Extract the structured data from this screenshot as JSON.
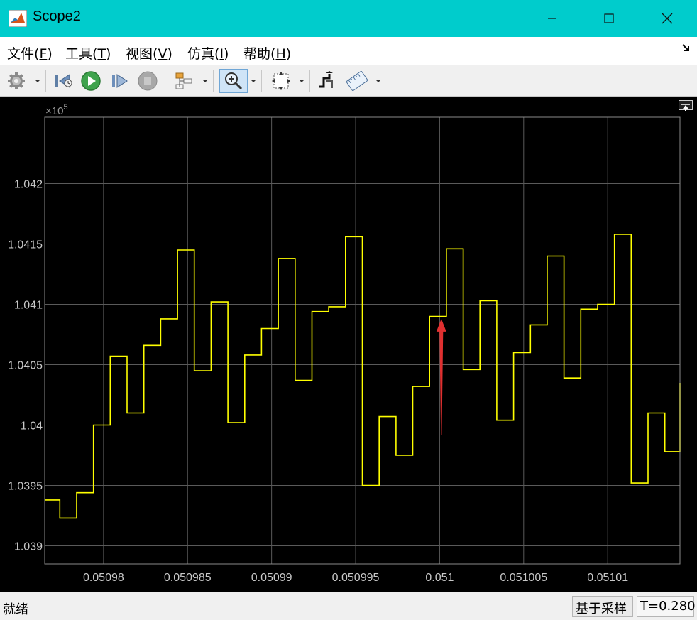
{
  "window": {
    "title": "Scope2"
  },
  "menu": {
    "items": [
      {
        "label": "文件",
        "accel": "F"
      },
      {
        "label": "工具",
        "accel": "T"
      },
      {
        "label": "视图",
        "accel": "V"
      },
      {
        "label": "仿真",
        "accel": "I"
      },
      {
        "label": "帮助",
        "accel": "H"
      }
    ]
  },
  "toolbar": {
    "icons": [
      "gear-icon",
      "step-back-icon",
      "run-icon",
      "step-forward-icon",
      "stop-icon",
      "signal-selector-icon",
      "zoom-in-icon",
      "fit-axes-icon",
      "triggers-icon",
      "cursor-measure-icon"
    ]
  },
  "colors": {
    "titlebar": "#00cccc",
    "plot_bg": "#000000",
    "trace": "#ffff00",
    "grid": "#5a5a5a",
    "arrow": "#e03030"
  },
  "chart_data": {
    "type": "line",
    "step": true,
    "exponent_label": "×10",
    "exponent_power": "5",
    "xlim": [
      0.0509765,
      0.0510143
    ],
    "ylim": [
      1.03885,
      1.04255
    ],
    "xticks": [
      0.05098,
      0.050985,
      0.05099,
      0.050995,
      0.051,
      0.051005,
      0.05101
    ],
    "xtick_labels": [
      "0.05098",
      "0.050985",
      "0.05099",
      "0.050995",
      "0.051",
      "0.051005",
      "0.05101"
    ],
    "yticks": [
      1.039,
      1.0395,
      1.04,
      1.0405,
      1.041,
      1.0415,
      1.042
    ],
    "ytick_labels": [
      "1.039",
      "1.0395",
      "1.04",
      "1.0405",
      "1.041",
      "1.0415",
      "1.042"
    ],
    "grid": true,
    "series": [
      {
        "x": [
          0.0509765,
          0.0509774,
          0.0509784,
          0.0509794,
          0.0509804,
          0.0509814,
          0.0509824,
          0.0509834,
          0.0509844,
          0.0509854,
          0.0509864,
          0.0509874,
          0.0509884,
          0.0509894,
          0.0509904,
          0.0509914,
          0.0509924,
          0.0509934,
          0.0509944,
          0.0509954,
          0.0509964,
          0.0509974,
          0.0509984,
          0.0509994,
          0.0510004,
          0.0510014,
          0.0510024,
          0.0510034,
          0.0510044,
          0.0510054,
          0.0510064,
          0.0510074,
          0.0510084,
          0.0510094,
          0.0510104,
          0.0510114,
          0.0510124,
          0.0510134,
          0.0510143
        ],
        "y": [
          1.03938,
          1.03923,
          1.03944,
          1.04,
          1.04057,
          1.0401,
          1.04066,
          1.04088,
          1.04145,
          1.04045,
          1.04102,
          1.04002,
          1.04058,
          1.0408,
          1.04138,
          1.04037,
          1.04094,
          1.04098,
          1.04156,
          1.0395,
          1.04007,
          1.03975,
          1.04032,
          1.0409,
          1.04146,
          1.04046,
          1.04103,
          1.04004,
          1.0406,
          1.04083,
          1.0414,
          1.04039,
          1.04096,
          1.041,
          1.04158,
          1.03952,
          1.0401,
          1.03978,
          1.04035
        ]
      }
    ],
    "annotations": [
      {
        "type": "arrow",
        "from": [
          0.0510001,
          1.03992
        ],
        "to": [
          0.0510001,
          1.04088
        ]
      }
    ]
  },
  "status": {
    "left": "就绪",
    "mode": "基于采样",
    "time": "T=0.280"
  }
}
